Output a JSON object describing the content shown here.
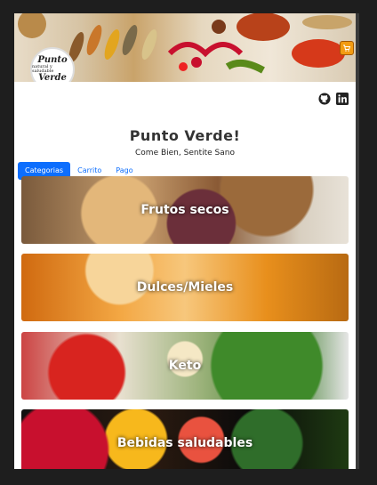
{
  "brand": {
    "logo_line1": "Punto",
    "logo_line2": "natural y saludable",
    "logo_line3": "Verde"
  },
  "header": {
    "cart_icon": "shopping-cart-icon",
    "github_icon": "github-icon",
    "linkedin_icon": "linkedin-icon"
  },
  "main": {
    "title": "Punto Verde!",
    "subtitle": "Come Bien, Sentite Sano"
  },
  "tabs": [
    {
      "label": "Categorias",
      "active": true
    },
    {
      "label": "Carrito",
      "active": false
    },
    {
      "label": "Pago",
      "active": false
    }
  ],
  "categories": [
    {
      "label": "Frutos secos"
    },
    {
      "label": "Dulces/Mieles"
    },
    {
      "label": "Keto"
    },
    {
      "label": "Bebidas saludables"
    }
  ],
  "colors": {
    "accent": "#0d6efd",
    "cart_button": "#f39c12"
  }
}
